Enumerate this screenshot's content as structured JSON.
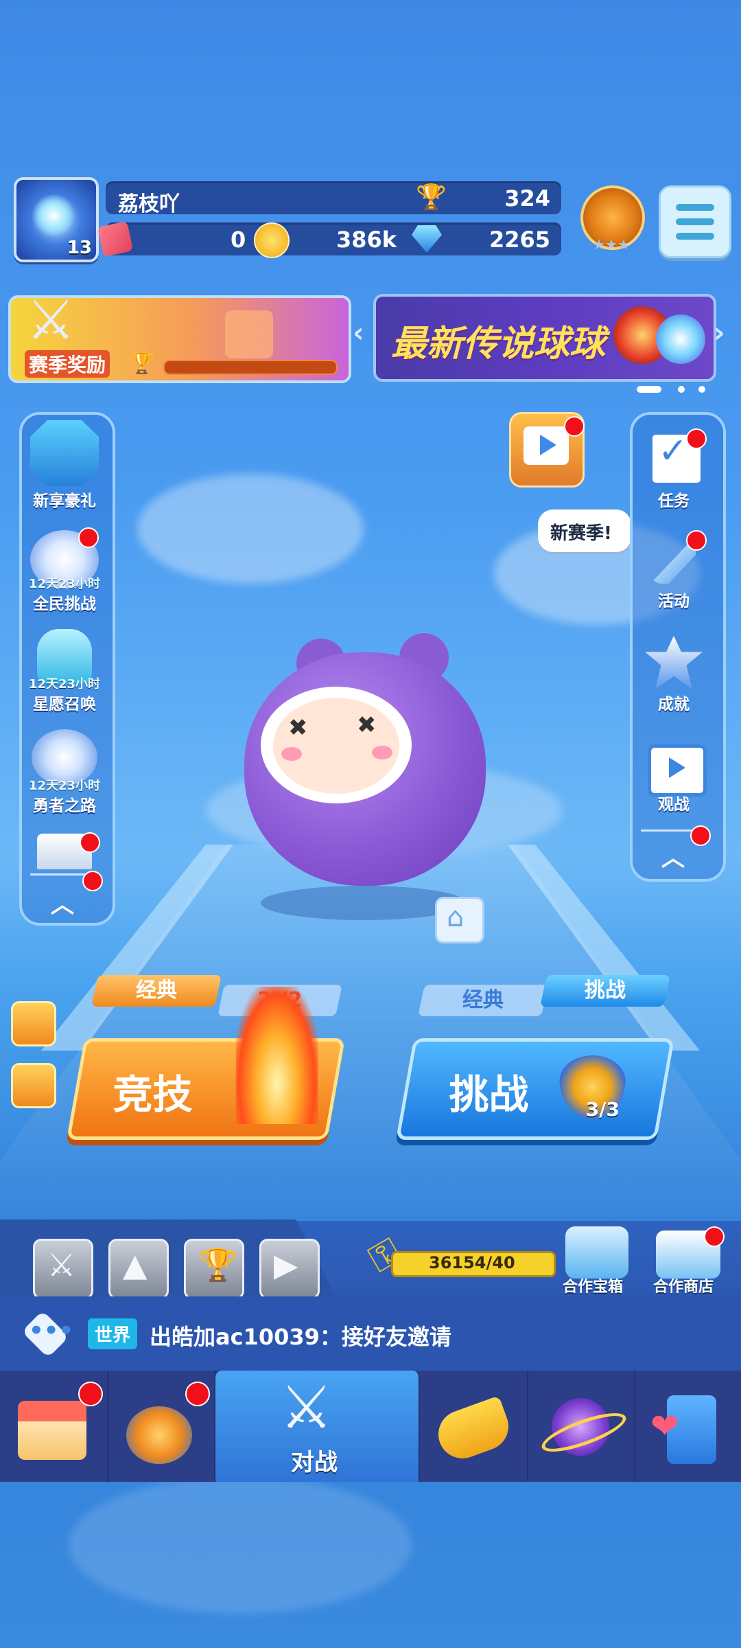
{
  "player": {
    "name": "荔枝吖",
    "level": "13",
    "trophies": "324",
    "tickets": "0",
    "coins": "386k",
    "gems": "2265"
  },
  "banners": {
    "season_reward": "赛季奖励",
    "legend_ball": "最新传说球球"
  },
  "left_panel": [
    {
      "label": "新享豪礼",
      "timer": ""
    },
    {
      "label": "全民挑战",
      "timer": "12天23小时"
    },
    {
      "label": "星愿召唤",
      "timer": "12天23小时"
    },
    {
      "label": "勇者之路",
      "timer": "12天23小时"
    }
  ],
  "right_panel": [
    {
      "label": "任务"
    },
    {
      "label": "活动"
    },
    {
      "label": "成就"
    },
    {
      "label": "观战"
    }
  ],
  "speech_bubble": "新赛季!",
  "modes": {
    "left_tab_active": "经典",
    "left_tab_inactive": "2V2",
    "left_button": "竞技",
    "right_tab_inactive": "经典",
    "right_tab_active": "挑战",
    "right_button": "挑战",
    "right_count": "3/3"
  },
  "key_progress": "36154/40",
  "coop": {
    "chest": "合作宝箱",
    "shop": "合作商店"
  },
  "chat": {
    "channel": "世界",
    "message": "出皓加ac10039：接好友邀请"
  },
  "nav": {
    "active_label": "对战"
  },
  "colors": {
    "accent_orange": "#f79a2a",
    "accent_blue": "#2fa0f2",
    "notify_red": "#f1101a"
  }
}
